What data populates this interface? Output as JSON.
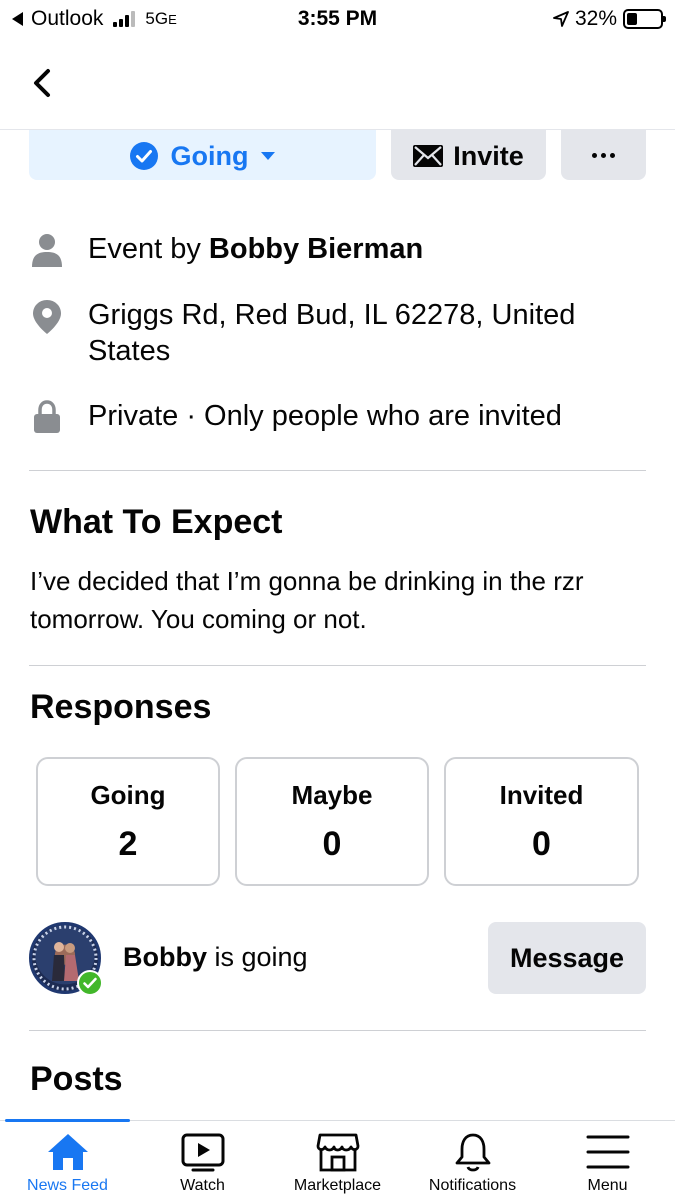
{
  "status_bar": {
    "back_app": "Outlook",
    "network": "5G",
    "network_suffix": "E",
    "time": "3:55 PM",
    "battery": "32%",
    "battery_level": 0.32
  },
  "actions": {
    "going_label": "Going",
    "invite_label": "Invite"
  },
  "info": {
    "event_by_prefix": "Event by ",
    "host": "Bobby Bierman",
    "location": "Griggs Rd, Red Bud, IL 62278, United States",
    "privacy": "Private · Only people who are invited"
  },
  "what_to_expect": {
    "title": "What To Expect",
    "text": "I’ve decided that I’m gonna be drinking in the rzr tomorrow. You coming or not."
  },
  "responses": {
    "title": "Responses",
    "cards": [
      {
        "label": "Going",
        "count": "2"
      },
      {
        "label": "Maybe",
        "count": "0"
      },
      {
        "label": "Invited",
        "count": "0"
      }
    ]
  },
  "attendee": {
    "name": "Bobby",
    "status": " is going",
    "message_label": "Message"
  },
  "posts": {
    "title": "Posts"
  },
  "tab_bar": {
    "items": [
      {
        "label": "News Feed",
        "icon": "home-icon"
      },
      {
        "label": "Watch",
        "icon": "watch-icon"
      },
      {
        "label": "Marketplace",
        "icon": "marketplace-icon"
      },
      {
        "label": "Notifications",
        "icon": "bell-icon"
      },
      {
        "label": "Menu",
        "icon": "menu-icon"
      }
    ]
  },
  "colors": {
    "accent": "#1877f2",
    "going_bg": "#e7f3ff",
    "button_bg": "#e4e6eb",
    "check_green": "#42b72a"
  }
}
